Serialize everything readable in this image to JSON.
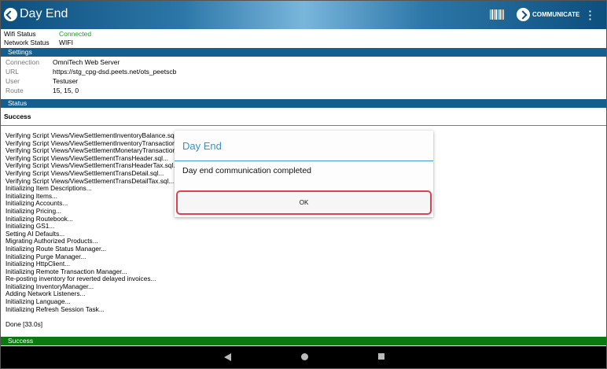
{
  "header": {
    "title": "Day End",
    "communicate_label": "COMMUNICATE"
  },
  "connectivity": {
    "wifi_label": "Wifi Status",
    "wifi_value": "Connected",
    "network_label": "Network Status",
    "network_value": "WIFI"
  },
  "settings": {
    "heading": "Settings",
    "connection_label": "Connection",
    "connection_value": "OmniTech Web Server",
    "url_label": "URL",
    "url_value": "https://stg_cpg-dsd.peets.net/ots_peetscb",
    "user_label": "User",
    "user_value": "Testuser",
    "route_label": "Route",
    "route_value": "15, 15, 0"
  },
  "status": {
    "heading": "Status",
    "result": "Success",
    "log_lines": [
      "Verifying Script Views/ViewSettlementInventoryBalance.sql...",
      "Verifying Script Views/ViewSettlementInventoryTransactions.sql...",
      "Verifying Script Views/ViewSettlementMonetaryTransactions.sql...",
      "Verifying Script Views/ViewSettlementTransHeader.sql...",
      "Verifying Script Views/ViewSettlementTransHeaderTax.sql...",
      "Verifying Script Views/ViewSettlementTransDetail.sql...",
      "Verifying Script Views/ViewSettlementTransDetailTax.sql...",
      "Initializing Item Descriptions...",
      "Initializing Items...",
      "Initializing Accounts...",
      "Initializing Pricing...",
      "Initializing Routebook...",
      "Initializing GS1...",
      "Setting AI Defaults...",
      "Migrating Authorized Products...",
      "Initializing Route Status Manager...",
      "Initializing Purge Manager...",
      "Initializing HttpClient...",
      "Initializing Remote Transaction Manager...",
      "Re-posting inventory for reverted delayed invoices...",
      "Initializing InventoryManager...",
      "Adding Network Listeners...",
      "Initializing Language...",
      "Initializing Refresh Session Task..."
    ],
    "done": "Done [33.0s]",
    "footer": "Success"
  },
  "dialog": {
    "title": "Day End",
    "message": "Day end communication completed",
    "ok_label": "OK"
  },
  "colors": {
    "accent": "#155f8f",
    "success": "#0a7a10",
    "connected": "#1c9c22",
    "highlight": "#e04050"
  }
}
